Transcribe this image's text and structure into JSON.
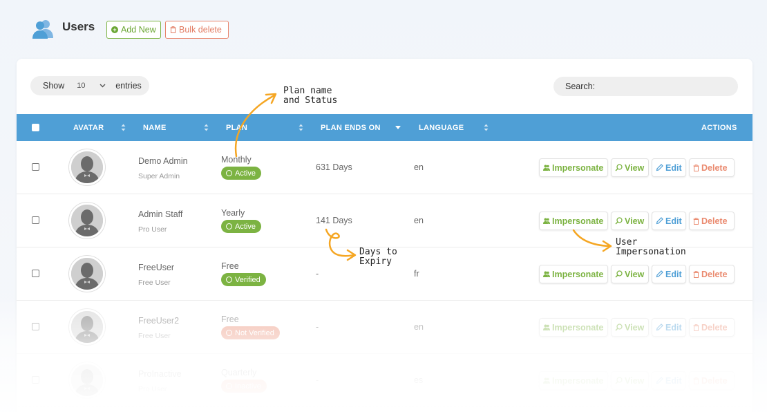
{
  "page": {
    "title": "Users",
    "add_new": "Add New",
    "bulk_delete": "Bulk delete"
  },
  "table_controls": {
    "show_label": "Show",
    "page_length": "10",
    "entries_label": "entries",
    "search_label": "Search:",
    "search_value": ""
  },
  "columns": {
    "avatar": "AVATAR",
    "name": "NAME",
    "plan": "PLAN",
    "plan_ends_on": "PLAN ENDS ON",
    "language": "LANGUAGE",
    "actions": "ACTIONS"
  },
  "rows": [
    {
      "name": "Demo Admin",
      "role": "Super Admin",
      "plan": "Monthly",
      "status": "Active",
      "ends": "631 Days",
      "lang": "en"
    },
    {
      "name": "Admin Staff",
      "role": "Pro User",
      "plan": "Yearly",
      "status": "Active",
      "ends": "141 Days",
      "lang": "en"
    },
    {
      "name": "FreeUser",
      "role": "Free User",
      "plan": "Free",
      "status": "Verified",
      "ends": "-",
      "lang": "fr"
    },
    {
      "name": "FreeUser2",
      "role": "Free User",
      "plan": "Free",
      "status": "Not Verified",
      "ends": "-",
      "lang": "en"
    },
    {
      "name": "ProInactive",
      "role": "Pro User",
      "plan": "Quarterly",
      "status": "Inactive",
      "ends": "-",
      "lang": "es"
    }
  ],
  "actions": {
    "impersonate": "Impersonate",
    "view": "View",
    "edit": "Edit",
    "delete": "Delete"
  },
  "annotations": {
    "plan_line1": "Plan name",
    "plan_line2": "and Status",
    "days_line1": "Days to",
    "days_line2": "Expiry",
    "imp_line1": "User",
    "imp_line2": "Impersonation"
  },
  "colors": {
    "header_blue": "#4f9fd6",
    "green": "#7cb342",
    "red": "#ea8a6f",
    "arrow_orange": "#f5a623"
  }
}
